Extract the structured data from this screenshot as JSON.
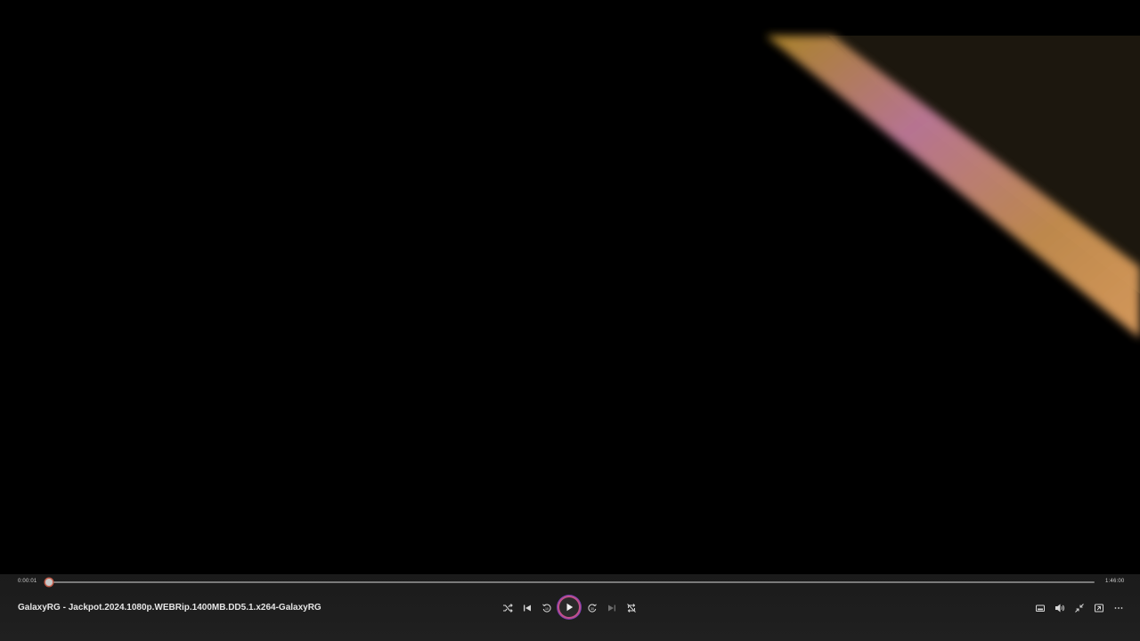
{
  "player": {
    "title": "GalaxyRG - Jackpot.2024.1080p.WEBRip.1400MB.DD5.1.x264-GalaxyRG",
    "time_elapsed": "0:00:01",
    "time_total": "1:46:00",
    "progress_fraction": 0.0
  },
  "controls": {
    "center": [
      "shuffle-icon",
      "previous-icon",
      "skip-back-10-icon",
      "play-icon",
      "skip-forward-30-icon",
      "next-icon",
      "repeat-off-icon"
    ],
    "right": [
      "miniplayer-icon",
      "volume-icon",
      "exit-fullscreen-icon",
      "cast-icon",
      "more-icon"
    ]
  },
  "colors": {
    "background": "#000000",
    "control_bar": "#1e1e1e",
    "accent_ring": "#c0508a",
    "seek_thumb_ring": "#c25c4a"
  }
}
